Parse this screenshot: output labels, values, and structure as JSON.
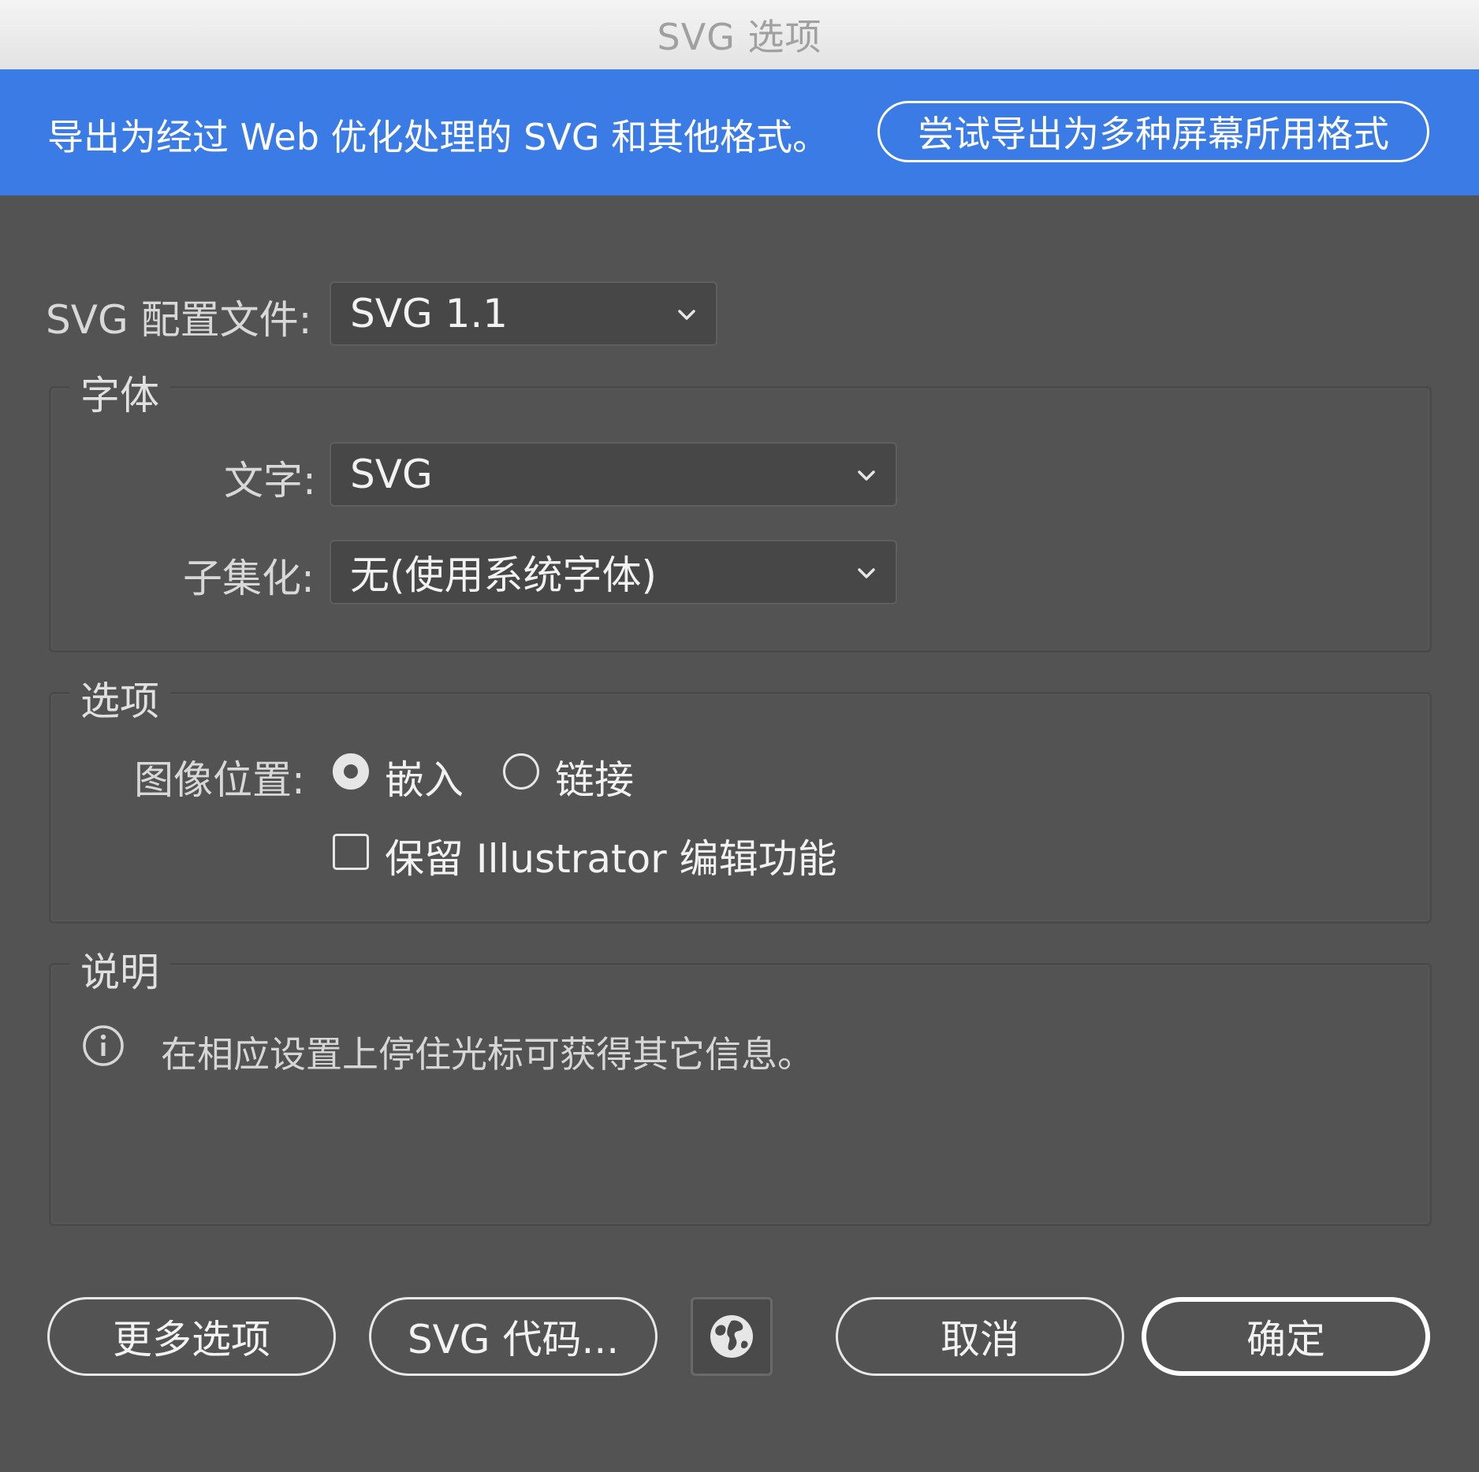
{
  "window": {
    "title": "SVG 选项"
  },
  "banner": {
    "text": "导出为经过 Web 优化处理的 SVG 和其他格式。",
    "button_label": "尝试导出为多种屏幕所用格式"
  },
  "profile": {
    "label": "SVG 配置文件:",
    "value": "SVG 1.1"
  },
  "fonts_group": {
    "title": "字体",
    "type_label": "文字:",
    "type_value": "SVG",
    "subset_label": "子集化:",
    "subset_value": "无(使用系统字体)"
  },
  "options_group": {
    "title": "选项",
    "image_location_label": "图像位置:",
    "radio_embed": {
      "label": "嵌入",
      "checked": true
    },
    "radio_link": {
      "label": "链接",
      "checked": false
    },
    "preserve_checkbox": {
      "label": "保留 Illustrator 编辑功能",
      "checked": false
    }
  },
  "description_group": {
    "title": "说明",
    "text": "在相应设置上停住光标可获得其它信息。",
    "icon": "info-icon"
  },
  "footer": {
    "more_options": "更多选项",
    "svg_code": "SVG 代码...",
    "globe_icon": "globe-icon",
    "cancel": "取消",
    "ok": "确定"
  },
  "colors": {
    "banner": "#3b7be6",
    "dialog_background": "#535353",
    "titlebar": "#e9e9e9"
  }
}
